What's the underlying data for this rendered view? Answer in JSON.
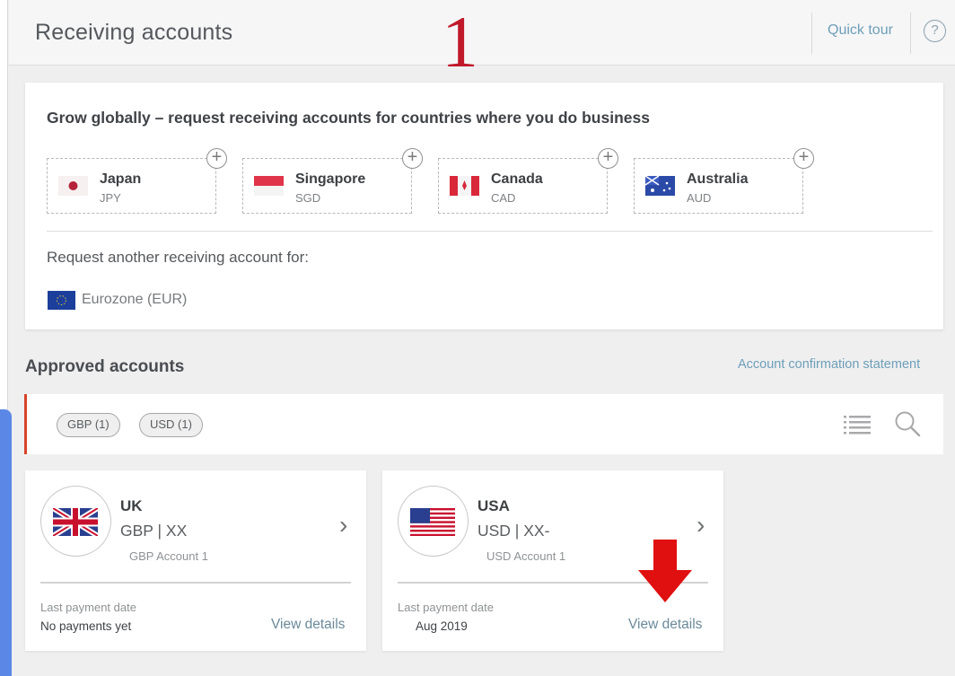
{
  "header": {
    "title": "Receiving accounts",
    "annotation_number": "1",
    "quick_tour_label": "Quick tour",
    "help_label": "?"
  },
  "grow": {
    "title": "Grow globally – request receiving accounts for countries where you do business",
    "countries": [
      {
        "name": "Japan",
        "code": "JPY",
        "flag_icon": "japan-flag-icon"
      },
      {
        "name": "Singapore",
        "code": "SGD",
        "flag_icon": "singapore-flag-icon"
      },
      {
        "name": "Canada",
        "code": "CAD",
        "flag_icon": "canada-flag-icon"
      },
      {
        "name": "Australia",
        "code": "AUD",
        "flag_icon": "australia-flag-icon"
      }
    ],
    "request_another": "Request another receiving account for:",
    "eurozone_label": "Eurozone (EUR)"
  },
  "approved": {
    "title": "Approved accounts",
    "confirmation_link": "Account confirmation statement",
    "filters": [
      "GBP (1)",
      "USD (1)"
    ],
    "accounts": [
      {
        "country": "UK",
        "number": "GBP | XX",
        "account_name": "GBP Account 1",
        "last_payment_label": "Last payment date",
        "last_payment_value": "No payments yet",
        "view_details": "View details",
        "flag_icon": "uk-flag-icon"
      },
      {
        "country": "USA",
        "number": "USD | XX-",
        "account_name": "USD Account 1",
        "last_payment_label": "Last payment date",
        "last_payment_value": "Aug 2019",
        "view_details": "View details",
        "flag_icon": "usa-flag-icon"
      }
    ]
  },
  "colors": {
    "accent_red": "#d6442b",
    "annotation_red": "#c0192a",
    "link_blue": "#6d9fb8",
    "arrow_red": "#e01010"
  }
}
